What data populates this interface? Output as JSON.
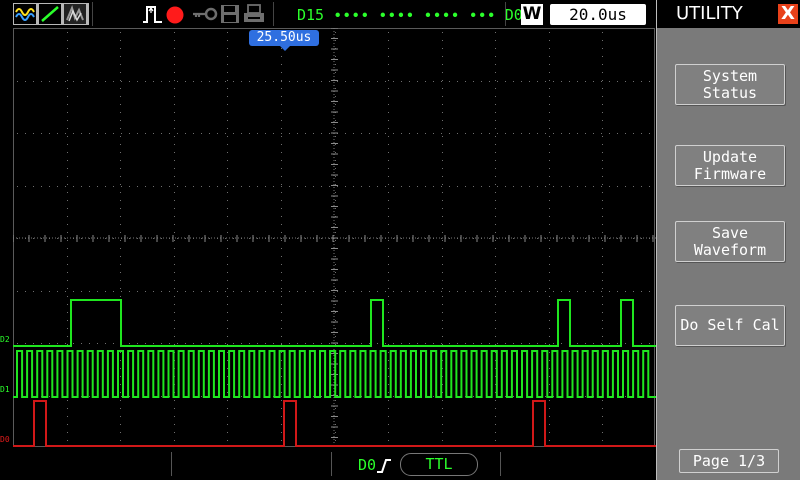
{
  "topbar": {
    "icons": [
      "waveform-display-icon",
      "vector-draw-icon",
      "persistence-icon",
      "trigger-pulse-icon",
      "run-stop-icon",
      "key-lock-icon",
      "save-disk-icon",
      "printer-icon"
    ],
    "channel_range": "D15 ∙∙∙∙ ∙∙∙∙ ∙∙∙∙ ∙∙∙ D0",
    "w_badge": "W",
    "timebase": "20.0us",
    "run_color": "#ff1b1b"
  },
  "screen": {
    "trigger_position": "25.50us",
    "channel_labels": [
      "D2",
      "D1",
      "D0"
    ],
    "channel_colors": [
      "#2bff2b",
      "#2bff2b",
      "#e21b1b"
    ],
    "trace_colors": {
      "digital_green": "#1fe61f",
      "digital_red": "#d01818",
      "grid": "#8a8a8a"
    }
  },
  "bottombar": {
    "trigger_source": "D0",
    "trigger_level": "TTL"
  },
  "menu": {
    "title": "UTILITY",
    "close_label": "X",
    "buttons": [
      "System\nStatus",
      "Update\nFirmware",
      "Save\nWaveform",
      "Do Self Cal"
    ],
    "page": "Page 1/3"
  }
}
